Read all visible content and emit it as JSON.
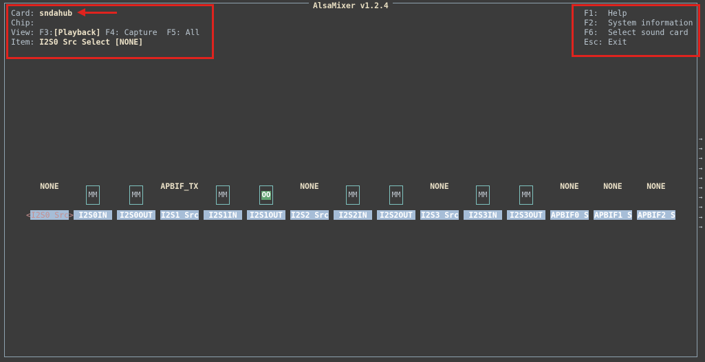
{
  "window": {
    "title": "AlsaMixer v1.2.4"
  },
  "header": {
    "card_label": "Card:",
    "card_value": "sndahub",
    "chip_label": "Chip:",
    "chip_value": "",
    "view_label": "View:",
    "view_f3": "F3:",
    "view_playback": "[Playback]",
    "view_f4": "F4: Capture",
    "view_f5": "F5: All",
    "item_label": "Item:",
    "item_value": "I2S0 Src Select [NONE]"
  },
  "help": [
    {
      "key": "F1:",
      "text": "Help"
    },
    {
      "key": "F2:",
      "text": "System information"
    },
    {
      "key": "F6:",
      "text": "Select sound card"
    },
    {
      "key": "Esc:",
      "text": "Exit"
    }
  ],
  "controls": [
    {
      "label": "I2S0 Src",
      "type": "enum",
      "value": "NONE",
      "selected": true
    },
    {
      "label": "I2S0IN",
      "type": "switch",
      "value": "MM"
    },
    {
      "label": "I2S0OUT",
      "type": "switch",
      "value": "MM"
    },
    {
      "label": "I2S1 Src",
      "type": "enum",
      "value": "APBIF_TX"
    },
    {
      "label": "I2S1IN",
      "type": "switch",
      "value": "MM"
    },
    {
      "label": "I2S1OUT",
      "type": "switch",
      "value": "OO"
    },
    {
      "label": "I2S2 Src",
      "type": "enum",
      "value": "NONE"
    },
    {
      "label": "I2S2IN",
      "type": "switch",
      "value": "MM"
    },
    {
      "label": "I2S2OUT",
      "type": "switch",
      "value": "MM"
    },
    {
      "label": "I2S3 Src",
      "type": "enum",
      "value": "NONE"
    },
    {
      "label": "I2S3IN",
      "type": "switch",
      "value": "MM"
    },
    {
      "label": "I2S3OUT",
      "type": "switch",
      "value": "MM"
    },
    {
      "label": "APBIF0 S",
      "type": "enum",
      "value": "NONE"
    },
    {
      "label": "APBIF1 S",
      "type": "enum",
      "value": "NONE"
    },
    {
      "label": "APBIF2 S",
      "type": "enum",
      "value": "NONE"
    }
  ],
  "selection_brackets": {
    "left": "<",
    "right": ">"
  },
  "scroll_indicator": "→\n→\n→\n→\n→\n→\n→\n→\n→\n→"
}
